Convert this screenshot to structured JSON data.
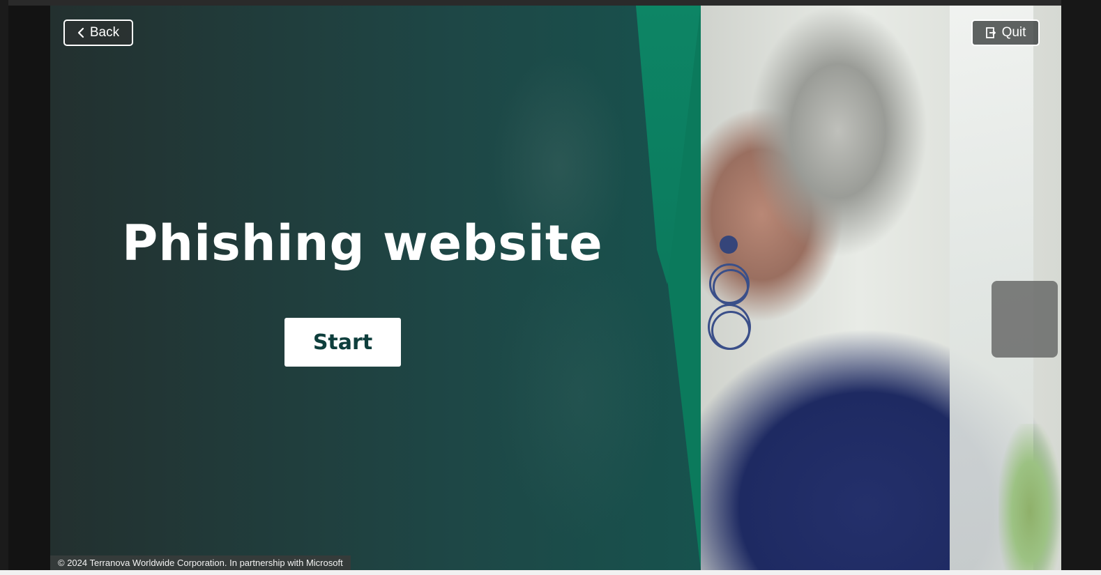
{
  "header": {
    "back_label": "Back",
    "quit_label": "Quit",
    "back_icon": "chevron-left-icon",
    "quit_icon": "exit-door-icon"
  },
  "main": {
    "title": "Phishing website",
    "start_label": "Start"
  },
  "footer": {
    "copyright": "© 2024 Terranova Worldwide Corporation. In partnership with Microsoft"
  },
  "colors": {
    "panel_green": "#145751",
    "accent_green": "#0b7a5c",
    "start_text": "#0e3e3c",
    "button_border": "#ffffff"
  }
}
